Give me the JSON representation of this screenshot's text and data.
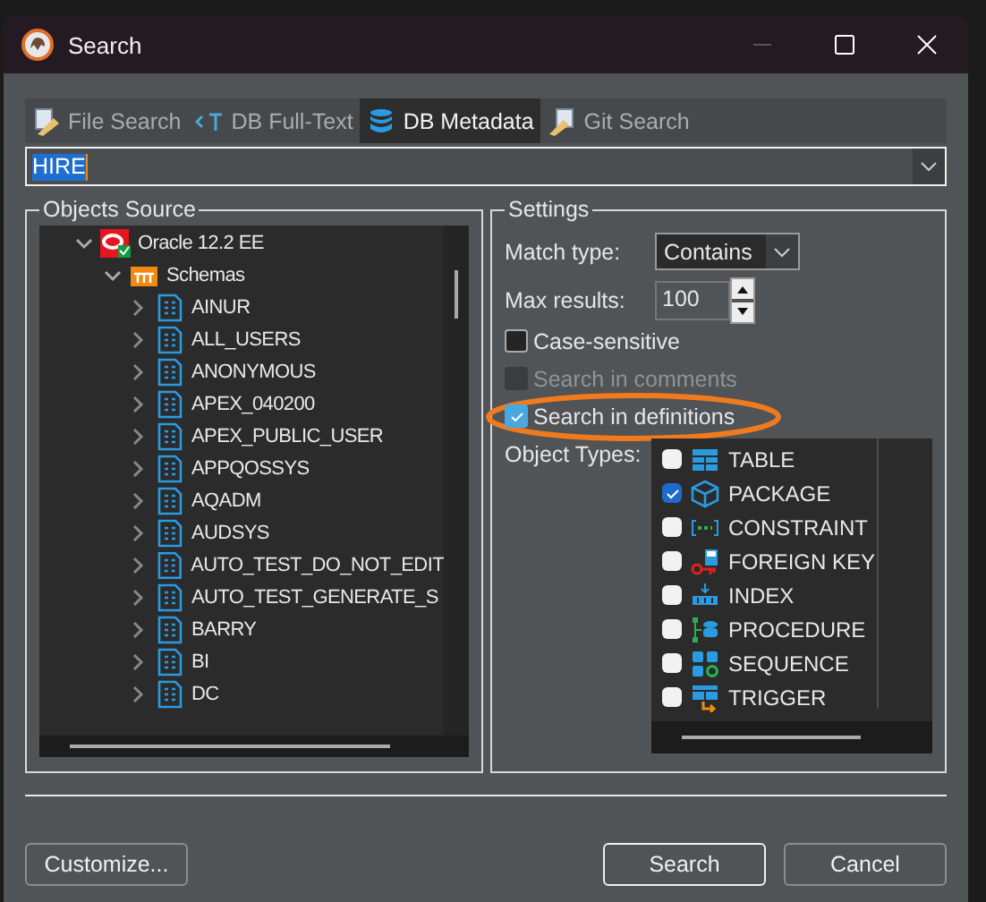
{
  "window": {
    "title": "Search",
    "controls": [
      {
        "kind": "minimize",
        "disabled": true
      },
      {
        "kind": "maximize",
        "disabled": false
      },
      {
        "kind": "close",
        "disabled": false
      }
    ]
  },
  "tabs": [
    {
      "label": "File Search",
      "kind": "file",
      "selected": false
    },
    {
      "label": "DB Full-Text",
      "kind": "text",
      "selected": false
    },
    {
      "label": "DB Metadata",
      "kind": "db",
      "selected": true
    },
    {
      "label": "Git Search",
      "kind": "git",
      "selected": false
    }
  ],
  "search": {
    "value": "HIRE"
  },
  "objects_source": {
    "title": "Objects Source",
    "tree": [
      {
        "label": "Oracle 12.2 EE",
        "kind": "connection",
        "expanded": true,
        "children": [
          {
            "label": "Schemas",
            "kind": "folder",
            "expanded": true,
            "children": [
              {
                "label": "AINUR",
                "kind": "schema",
                "expanded": false
              },
              {
                "label": "ALL_USERS",
                "kind": "schema",
                "expanded": false
              },
              {
                "label": "ANONYMOUS",
                "kind": "schema",
                "expanded": false
              },
              {
                "label": "APEX_040200",
                "kind": "schema",
                "expanded": false
              },
              {
                "label": "APEX_PUBLIC_USER",
                "kind": "schema",
                "expanded": false
              },
              {
                "label": "APPQOSSYS",
                "kind": "schema",
                "expanded": false
              },
              {
                "label": "AQADM",
                "kind": "schema",
                "expanded": false
              },
              {
                "label": "AUDSYS",
                "kind": "schema",
                "expanded": false
              },
              {
                "label": "AUTO_TEST_DO_NOT_EDIT",
                "kind": "schema",
                "expanded": false
              },
              {
                "label": "AUTO_TEST_GENERATE_S",
                "kind": "schema",
                "expanded": false
              },
              {
                "label": "BARRY",
                "kind": "schema",
                "expanded": false
              },
              {
                "label": "BI",
                "kind": "schema",
                "expanded": false
              },
              {
                "label": "DC",
                "kind": "schema",
                "expanded": false
              }
            ]
          }
        ]
      }
    ]
  },
  "settings": {
    "title": "Settings",
    "match_type": {
      "label": "Match type:",
      "value": "Contains"
    },
    "max_results": {
      "label": "Max results:",
      "value": "100"
    },
    "options": [
      {
        "label": "Case-sensitive",
        "checked": false,
        "disabled": false,
        "highlight": false
      },
      {
        "label": "Search in comments",
        "checked": false,
        "disabled": true,
        "highlight": false
      },
      {
        "label": "Search in definitions",
        "checked": true,
        "disabled": false,
        "highlight": true
      }
    ],
    "object_types_label": "Object Types:",
    "object_types": [
      {
        "label": "TABLE",
        "kind": "table",
        "checked": false
      },
      {
        "label": "PACKAGE",
        "kind": "package",
        "checked": true
      },
      {
        "label": "CONSTRAINT",
        "kind": "constraint",
        "checked": false
      },
      {
        "label": "FOREIGN KEY",
        "kind": "foreign_key",
        "checked": false
      },
      {
        "label": "INDEX",
        "kind": "index",
        "checked": false
      },
      {
        "label": "PROCEDURE",
        "kind": "procedure",
        "checked": false
      },
      {
        "label": "SEQUENCE",
        "kind": "sequence",
        "checked": false
      },
      {
        "label": "TRIGGER",
        "kind": "trigger",
        "checked": false
      }
    ]
  },
  "buttons": [
    {
      "label": "Customize...",
      "kind": "secondary"
    },
    {
      "label": "Search",
      "kind": "default"
    },
    {
      "label": "Cancel",
      "kind": "normal"
    }
  ]
}
